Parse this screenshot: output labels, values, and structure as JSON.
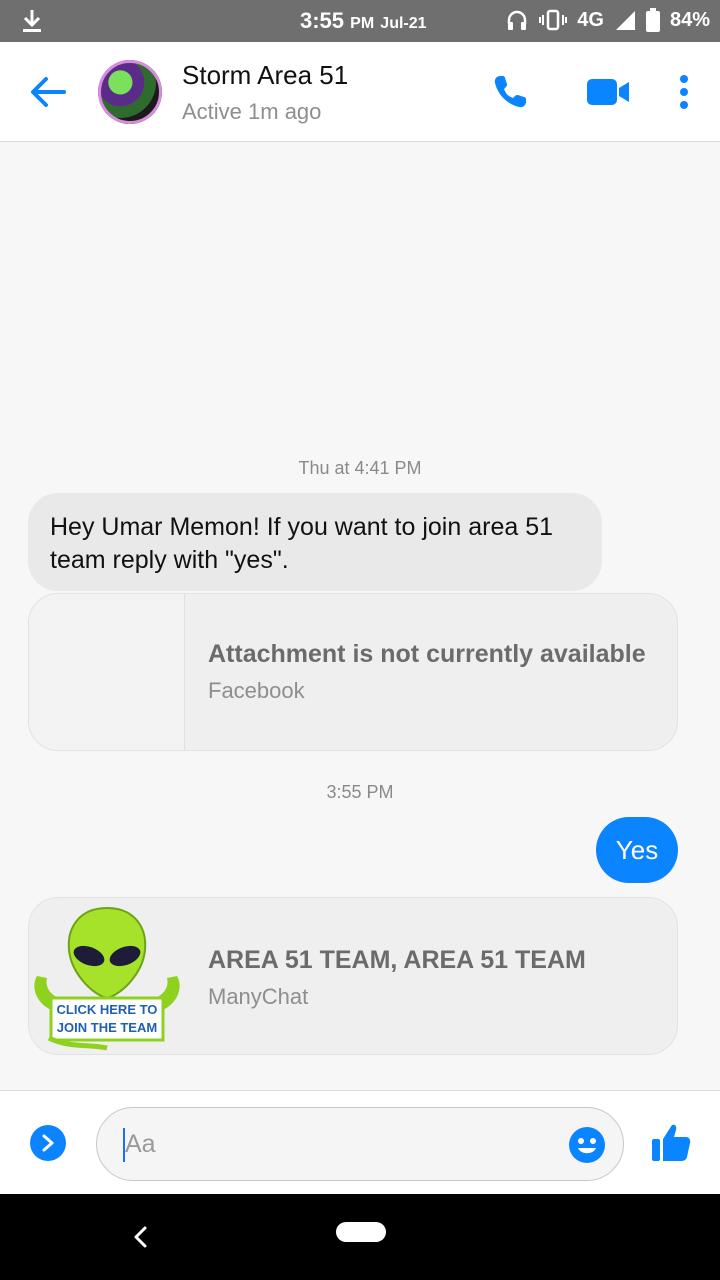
{
  "status_bar": {
    "time": "3:55",
    "ampm": "PM",
    "date": "Jul-21",
    "network": "4G",
    "battery": "84%",
    "icons": [
      "download-icon",
      "headphones-icon",
      "vibrate-icon",
      "signal-icon",
      "battery-icon"
    ]
  },
  "header": {
    "contact_name": "Storm Area 51",
    "status": "Active 1m ago",
    "icons": [
      "back-arrow-icon",
      "phone-icon",
      "video-icon",
      "more-vertical-icon"
    ],
    "accent": "#0a84ff"
  },
  "chat": {
    "timestamp_1": "Thu at 4:41 PM",
    "incoming_message": "Hey Umar Memon!  If you want to join area 51 team reply with \"yes\".",
    "attachment_1": {
      "title": "Attachment is not currently available",
      "source": "Facebook"
    },
    "timestamp_2": "3:55 PM",
    "outgoing_message": "Yes",
    "attachment_2": {
      "title": "AREA 51 TEAM, AREA 51 TEAM",
      "source": "ManyChat",
      "image_text_line1": "CLICK HERE TO",
      "image_text_line2": "JOIN THE TEAM"
    }
  },
  "composer": {
    "placeholder": "Aa",
    "icons": [
      "expand-icon",
      "emoji-icon",
      "thumbs-up-icon"
    ]
  },
  "nav": {
    "icons": [
      "nav-back-icon",
      "home-pill-icon"
    ]
  }
}
